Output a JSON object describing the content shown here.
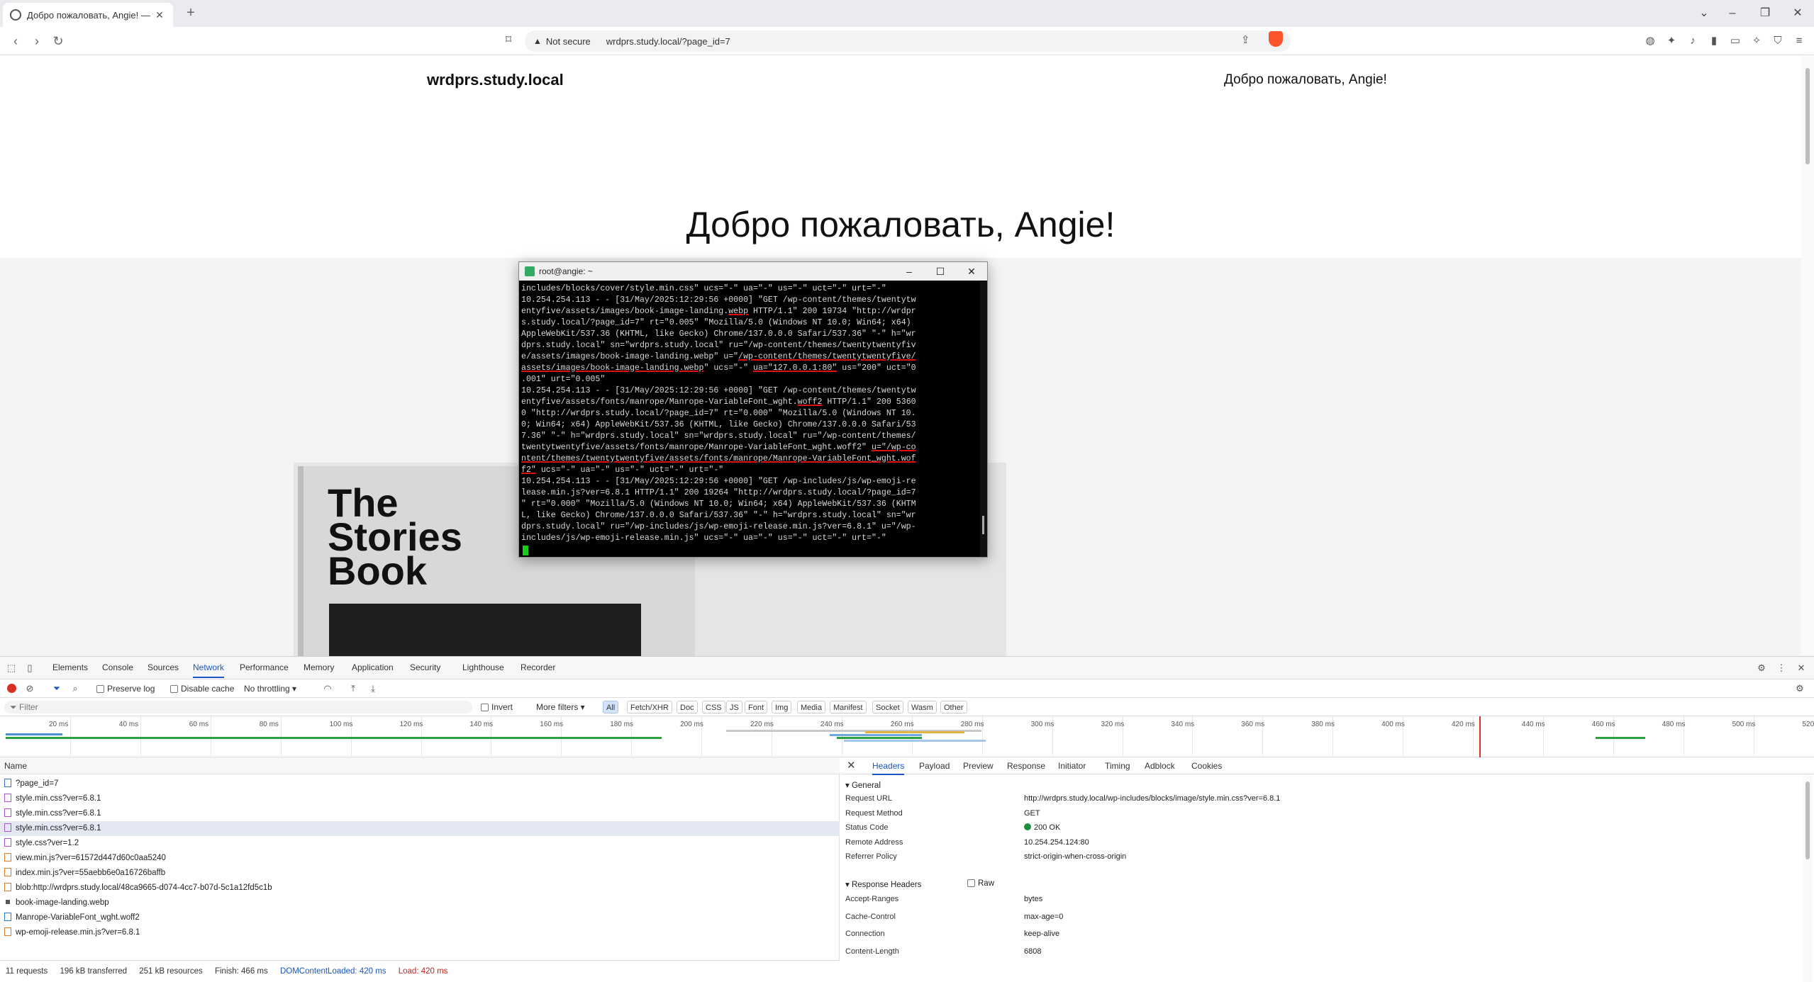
{
  "browser": {
    "tab_title": "Добро пожаловать, Angie! — w",
    "address": {
      "security_label": "Not secure",
      "url": "wrdprs.study.local/?page_id=7"
    }
  },
  "page": {
    "site_title": "wrdprs.study.local",
    "welcome_nav": "Добро пожаловать, Angie!",
    "hero_heading": "Добро пожаловать, Angie!",
    "book_title": "The Stories Book"
  },
  "terminal": {
    "title": "root@angie: ~",
    "log_excerpt": "GET /wp-content/themes/twentytwentyfive/assets/images/book-image-landing.webp; GET /wp-content/themes/twentytwentyfive/assets/fonts/manrope/Manrope-VariableFont_wght.woff2; GET /wp-includes/js/wp-emoji-release.min.js?ver=6.8.1"
  },
  "devtools": {
    "tabs": [
      "Elements",
      "Console",
      "Sources",
      "Network",
      "Performance",
      "Memory",
      "Application",
      "Security",
      "Lighthouse",
      "Recorder"
    ],
    "active_tab": "Network",
    "toolbar": {
      "preserve_log": "Preserve log",
      "disable_cache": "Disable cache",
      "throttling": "No throttling"
    },
    "filter": {
      "placeholder": "Filter",
      "invert": "Invert",
      "more_filters": "More filters"
    },
    "type_filters": [
      "All",
      "Fetch/XHR",
      "Doc",
      "CSS",
      "JS",
      "Font",
      "Img",
      "Media",
      "Manifest",
      "Socket",
      "Wasm",
      "Other"
    ],
    "active_type": "All",
    "timeline_ticks": [
      "20 ms",
      "40 ms",
      "60 ms",
      "80 ms",
      "100 ms",
      "120 ms",
      "140 ms",
      "160 ms",
      "180 ms",
      "200 ms",
      "220 ms",
      "240 ms",
      "260 ms",
      "280 ms",
      "300 ms",
      "320 ms",
      "340 ms",
      "360 ms",
      "380 ms",
      "400 ms",
      "420 ms",
      "440 ms",
      "460 ms",
      "480 ms",
      "500 ms",
      "520"
    ],
    "request_list": {
      "header": "Name",
      "rows": [
        {
          "name": "?page_id=7",
          "type": "doc"
        },
        {
          "name": "style.min.css?ver=6.8.1",
          "type": "css"
        },
        {
          "name": "style.min.css?ver=6.8.1",
          "type": "css"
        },
        {
          "name": "style.min.css?ver=6.8.1",
          "type": "css",
          "selected": true
        },
        {
          "name": "style.css?ver=1.2",
          "type": "css"
        },
        {
          "name": "view.min.js?ver=61572d447d60c0aa5240",
          "type": "js"
        },
        {
          "name": "index.min.js?ver=55aebb6e0a16726baffb",
          "type": "js"
        },
        {
          "name": "blob:http://wrdprs.study.local/48ca9665-d074-4cc7-b07d-5c1a12fd5c1b",
          "type": "js"
        },
        {
          "name": "book-image-landing.webp",
          "type": "img"
        },
        {
          "name": "Manrope-VariableFont_wght.woff2",
          "type": "font"
        },
        {
          "name": "wp-emoji-release.min.js?ver=6.8.1",
          "type": "js"
        }
      ]
    },
    "status_bar": {
      "requests": "11 requests",
      "transferred": "196 kB transferred",
      "resources": "251 kB resources",
      "finish": "Finish: 466 ms",
      "dom_loaded": "DOMContentLoaded: 420 ms",
      "load": "Load: 420 ms"
    },
    "detail": {
      "tabs": [
        "Headers",
        "Payload",
        "Preview",
        "Response",
        "Initiator",
        "Timing",
        "Adblock",
        "Cookies"
      ],
      "active_tab": "Headers",
      "general_title": "General",
      "general": [
        {
          "key": "Request URL",
          "value": "http://wrdprs.study.local/wp-includes/blocks/image/style.min.css?ver=6.8.1"
        },
        {
          "key": "Request Method",
          "value": "GET"
        },
        {
          "key": "Status Code",
          "value": "200 OK"
        },
        {
          "key": "Remote Address",
          "value": "10.254.254.124:80"
        },
        {
          "key": "Referrer Policy",
          "value": "strict-origin-when-cross-origin"
        }
      ],
      "response_title": "Response Headers",
      "raw_label": "Raw",
      "response": [
        {
          "key": "Accept-Ranges",
          "value": "bytes"
        },
        {
          "key": "Cache-Control",
          "value": "max-age=0"
        },
        {
          "key": "Connection",
          "value": "keep-alive"
        },
        {
          "key": "Content-Length",
          "value": "6808"
        }
      ]
    }
  },
  "colors": {
    "accent_blue": "#1a56c4",
    "record_red": "#d93025",
    "status_green": "#1e8e3e",
    "terminal_bg": "#000000",
    "terminal_cursor": "#1ec91e",
    "underline_red": "#e01010"
  }
}
